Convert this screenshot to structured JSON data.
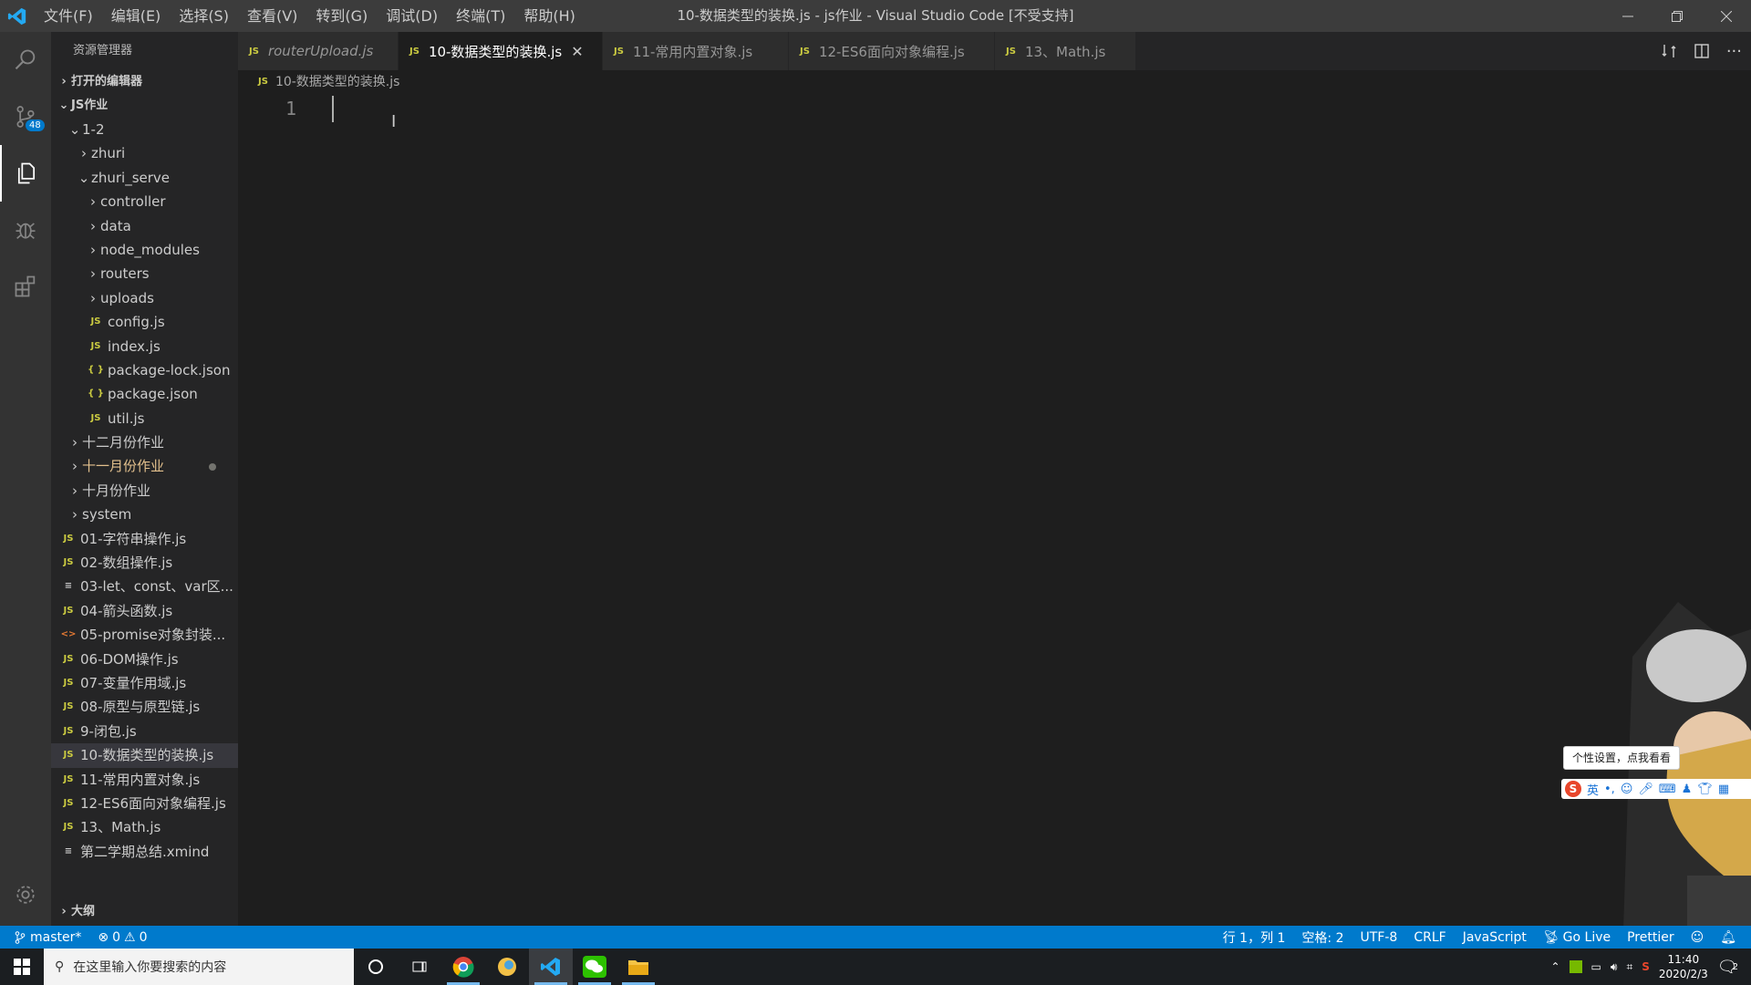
{
  "titlebar": {
    "menu": [
      "文件(F)",
      "编辑(E)",
      "选择(S)",
      "查看(V)",
      "转到(G)",
      "调试(D)",
      "终端(T)",
      "帮助(H)"
    ],
    "window_title": "10-数据类型的装换.js - js作业 - Visual Studio Code [不受支持]"
  },
  "activity": {
    "scm_badge": "48"
  },
  "sidebar": {
    "title": "资源管理器",
    "open_editors": "打开的编辑器",
    "root": "JS作业",
    "outline": "大纲",
    "tree": [
      {
        "label": "1-2",
        "depth": 1,
        "type": "folder-open"
      },
      {
        "label": "zhuri",
        "depth": 2,
        "type": "folder"
      },
      {
        "label": "zhuri_serve",
        "depth": 2,
        "type": "folder-open"
      },
      {
        "label": "controller",
        "depth": 3,
        "type": "folder"
      },
      {
        "label": "data",
        "depth": 3,
        "type": "folder"
      },
      {
        "label": "node_modules",
        "depth": 3,
        "type": "folder"
      },
      {
        "label": "routers",
        "depth": 3,
        "type": "folder"
      },
      {
        "label": "uploads",
        "depth": 3,
        "type": "folder"
      },
      {
        "label": "config.js",
        "depth": 3,
        "type": "js"
      },
      {
        "label": "index.js",
        "depth": 3,
        "type": "js"
      },
      {
        "label": "package-lock.json",
        "depth": 3,
        "type": "json"
      },
      {
        "label": "package.json",
        "depth": 3,
        "type": "json"
      },
      {
        "label": "util.js",
        "depth": 3,
        "type": "js"
      },
      {
        "label": "十二月份作业",
        "depth": 1,
        "type": "folder"
      },
      {
        "label": "十一月份作业",
        "depth": 1,
        "type": "folder",
        "modified": true
      },
      {
        "label": "十月份作业",
        "depth": 1,
        "type": "folder"
      },
      {
        "label": "system",
        "depth": 1,
        "type": "folder"
      },
      {
        "label": "01-字符串操作.js",
        "depth": 1,
        "type": "js-file"
      },
      {
        "label": "02-数组操作.js",
        "depth": 1,
        "type": "js-file"
      },
      {
        "label": "03-let、const、var区...",
        "depth": 1,
        "type": "txt"
      },
      {
        "label": "04-箭头函数.js",
        "depth": 1,
        "type": "js-file"
      },
      {
        "label": "05-promise对象封装...",
        "depth": 1,
        "type": "html"
      },
      {
        "label": "06-DOM操作.js",
        "depth": 1,
        "type": "js-file"
      },
      {
        "label": "07-变量作用域.js",
        "depth": 1,
        "type": "js-file"
      },
      {
        "label": "08-原型与原型链.js",
        "depth": 1,
        "type": "js-file"
      },
      {
        "label": "9-闭包.js",
        "depth": 1,
        "type": "js-file"
      },
      {
        "label": "10-数据类型的装换.js",
        "depth": 1,
        "type": "js-file",
        "selected": true
      },
      {
        "label": "11-常用内置对象.js",
        "depth": 1,
        "type": "js-file"
      },
      {
        "label": "12-ES6面向对象编程.js",
        "depth": 1,
        "type": "js-file"
      },
      {
        "label": "13、Math.js",
        "depth": 1,
        "type": "js-file"
      },
      {
        "label": "第二学期总结.xmind",
        "depth": 1,
        "type": "txt"
      }
    ]
  },
  "tabs": [
    {
      "label": "routerUpload.js",
      "italic": true
    },
    {
      "label": "10-数据类型的装换.js",
      "active": true
    },
    {
      "label": "11-常用内置对象.js"
    },
    {
      "label": "12-ES6面向对象编程.js"
    },
    {
      "label": "13、Math.js"
    }
  ],
  "breadcrumb": "10-数据类型的装换.js",
  "editor": {
    "line_number": "1"
  },
  "statusbar": {
    "branch": "master*",
    "errors": "0",
    "warnings": "0",
    "position": "行 1，列 1",
    "spaces": "空格: 2",
    "encoding": "UTF-8",
    "eol": "CRLF",
    "language": "JavaScript",
    "golive": "Go Live",
    "prettier": "Prettier"
  },
  "taskbar": {
    "search_placeholder": "在这里输入你要搜索的内容",
    "time": "11:40",
    "date": "2020/2/3",
    "notification_count": "2"
  },
  "ime": {
    "tip": "个性设置，点我看看",
    "mode": "英"
  }
}
